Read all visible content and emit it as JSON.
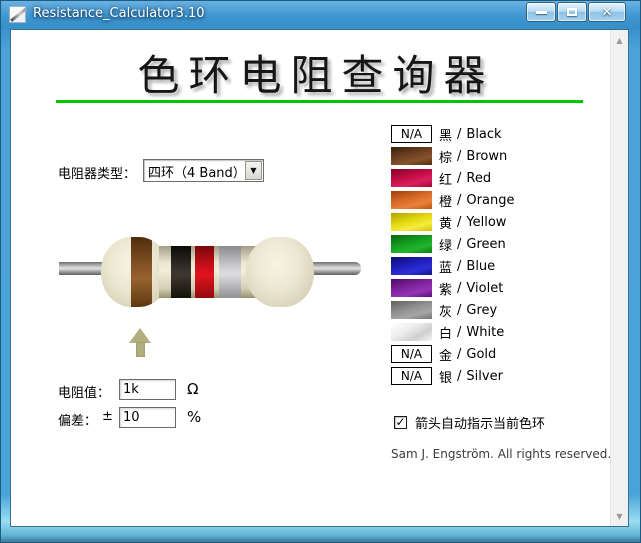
{
  "window": {
    "title": "Resistance_Calculator3.10",
    "controls": {
      "close_glyph": "✕"
    }
  },
  "header": {
    "title": "色环电阻查询器",
    "accent_color": "#00c600"
  },
  "type_selector": {
    "label": "电阻器类型：",
    "value": "四环（4 Band）",
    "arrow_glyph": "▼"
  },
  "resistor": {
    "body_color": "#ebe6d1",
    "bands": [
      {
        "color_name": "brown",
        "css": "linear-gradient(180deg,#4f2d0e,#8a5628 45%,#96622f 60%,#5e380f)"
      },
      {
        "color_name": "black",
        "css": "linear-gradient(180deg,#0c0a08,#36322b 45%,#3c3830 55%,#141109)"
      },
      {
        "color_name": "red",
        "css": "linear-gradient(180deg,#7c060b,#d5101c 45%,#e01520 55%,#94090e)"
      },
      {
        "color_name": "silver",
        "css": "linear-gradient(180deg,#8b8b8e,#d4d4d6 45%,#dcdcde 55%,#919194)"
      }
    ],
    "arrow_color": "#b2ae7e"
  },
  "fields": {
    "resistance": {
      "label": "电阻值：",
      "value": "1k",
      "unit": "Ω"
    },
    "tolerance": {
      "label": "偏差：",
      "plus_minus": "±",
      "value": "10",
      "unit": "%"
    }
  },
  "legend": {
    "na_label": "N/A",
    "separator": "/",
    "items": [
      {
        "zh": "黑",
        "en": "Black",
        "swatch": "na"
      },
      {
        "zh": "棕",
        "en": "Brown",
        "css": "linear-gradient(165deg,#3a2009 0%,#6f4223 45%,#86522c 70%,#512d0e 100%)"
      },
      {
        "zh": "红",
        "en": "Red",
        "css": "linear-gradient(165deg,#7e0526 0%,#c80d48 45%,#d92160 70%,#a50834 100%)"
      },
      {
        "zh": "橙",
        "en": "Orange",
        "css": "linear-gradient(165deg,#9c3f0e 0%,#d96c28 45%,#e8823a 70%,#bd5410 100%)"
      },
      {
        "zh": "黄",
        "en": "Yellow",
        "css": "linear-gradient(165deg,#b1a303 0%,#e6da10 45%,#f4ec40 70%,#cfc108 100%)"
      },
      {
        "zh": "绿",
        "en": "Green",
        "css": "linear-gradient(165deg,#07650d 0%,#15a021 45%,#23b52e 70%,#0d7d14 100%)"
      },
      {
        "zh": "蓝",
        "en": "Blue",
        "css": "linear-gradient(165deg,#0d0d6b 0%,#2020c0 45%,#2e2ed6 70%,#14148a 100%)"
      },
      {
        "zh": "紫",
        "en": "Violet",
        "css": "linear-gradient(165deg,#4c0c62 0%,#8224a2 45%,#9334b4 70%,#5c1076 100%)"
      },
      {
        "zh": "灰",
        "en": "Grey",
        "css": "linear-gradient(165deg,#616161 0%,#929292 45%,#a6a6a6 70%,#767676 100%)"
      },
      {
        "zh": "白",
        "en": "White",
        "css": "linear-gradient(150deg,#ffffff 0%,#ececec 40%,#cfcfcf 70%,#f6f6f6 100%)"
      },
      {
        "zh": "金",
        "en": "Gold",
        "swatch": "na"
      },
      {
        "zh": "银",
        "en": "Silver",
        "swatch": "na"
      }
    ]
  },
  "options": {
    "auto_arrow": {
      "checked": true,
      "check_glyph": "✓",
      "label": "箭头自动指示当前色环"
    }
  },
  "scrollbar": {
    "up_glyph": "▲",
    "down_glyph": "▼"
  },
  "footer": {
    "copyright": "Sam J. Engström. All rights reserved."
  }
}
